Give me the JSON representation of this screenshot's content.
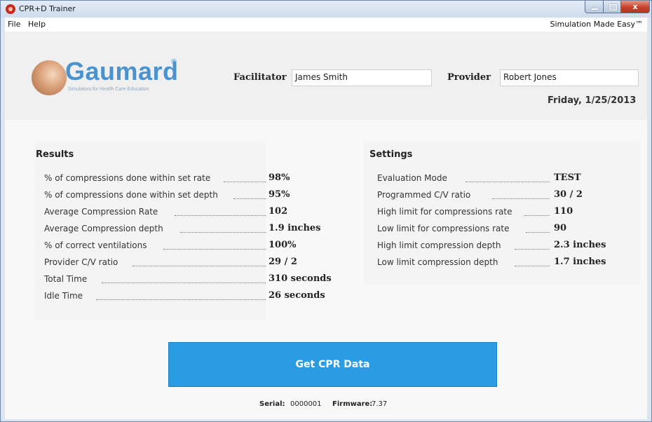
{
  "window": {
    "title": "CPR+D Trainer",
    "close_glyph": "x",
    "icons": [
      "app-icon",
      "minimize-icon",
      "maximize-icon",
      "close-icon"
    ]
  },
  "menu": {
    "file": "File",
    "help": "Help",
    "tagline": "Simulation Made Easy™"
  },
  "header": {
    "logo_text": "Gaumard",
    "logo_reg": "®",
    "logo_tagline": "Simulators for Health Care Education",
    "facilitator_label": "Facilitator",
    "facilitator_value": "James Smith",
    "provider_label": "Provider",
    "provider_value": "Robert Jones",
    "date": "Friday, 1/25/2013"
  },
  "results": {
    "title": "Results",
    "rows": [
      {
        "label": "% of compressions done within set rate",
        "value": "98%"
      },
      {
        "label": "% of compressions done within set depth",
        "value": "95%"
      },
      {
        "label": "Average Compression Rate",
        "value": "102"
      },
      {
        "label": "Average Compression depth",
        "value": "1.9 inches"
      },
      {
        "label": "% of correct ventilations",
        "value": "100%"
      },
      {
        "label": "Provider C/V ratio",
        "value": "29 / 2"
      },
      {
        "label": "Total Time",
        "value": "310 seconds"
      },
      {
        "label": "Idle Time",
        "value": "26 seconds"
      }
    ]
  },
  "settings": {
    "title": "Settings",
    "rows": [
      {
        "label": "Evaluation Mode",
        "value": "TEST"
      },
      {
        "label": "Programmed C/V ratio",
        "value": "30 / 2"
      },
      {
        "label": "High limit for compressions rate",
        "value": "110"
      },
      {
        "label": "Low limit for compressions rate",
        "value": "90"
      },
      {
        "label": "High limit compression depth",
        "value": "2.3 inches"
      },
      {
        "label": "Low limit compression depth",
        "value": "1.7 inches"
      }
    ]
  },
  "action": {
    "get_data": "Get CPR Data"
  },
  "footer": {
    "serial_label": "Serial:",
    "serial_value": "0000001",
    "firmware_label": "Firmware:",
    "firmware_value": "7.37"
  },
  "colors": {
    "accent": "#2b9be3",
    "logo": "#4a93cf"
  }
}
